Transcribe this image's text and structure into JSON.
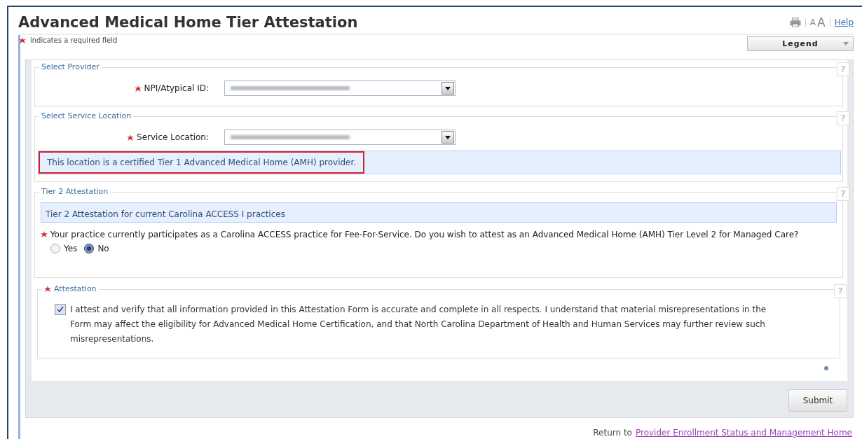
{
  "page": {
    "title": "Advanced Medical Home Tier Attestation",
    "text_size_small": "A",
    "text_size_large": "A",
    "help": "Help"
  },
  "required_note": "indicates a required field",
  "legend": {
    "label": "Legend"
  },
  "sections": [
    {
      "kind": "select",
      "legend": "Select Provider",
      "help_mark": "?",
      "field": {
        "label": "NPI/Atypical ID:",
        "required": true
      }
    },
    {
      "kind": "select",
      "legend": "Select Service Location",
      "help_mark": "?",
      "field": {
        "label": "Service Location:",
        "required": true
      },
      "notice": "This location is a certified Tier 1 Advanced Medical Home (AMH) provider.",
      "notice_highlighted": true
    },
    {
      "kind": "question",
      "legend": "Tier 2 Attestation",
      "help_mark": "?",
      "banner": "Tier 2 Attestation for current Carolina ACCESS I practices",
      "question": "Your practice currently participates as a Carolina ACCESS practice for Fee-For-Service. Do you wish to attest as an Advanced Medical Home (AMH) Tier Level 2 for Managed Care?",
      "required": true,
      "options": [
        {
          "label": "Yes",
          "selected": false
        },
        {
          "label": "No",
          "selected": true
        }
      ]
    },
    {
      "kind": "attestation",
      "legend": "Attestation",
      "help_mark": "?",
      "required": true,
      "checked": true,
      "text": "I attest and verify that all information provided in this Attestation Form is accurate and complete in all respects. I understand that material misrepresentations in the Form may affect the eligibility for Advanced Medical Home Certification, and that North Carolina Department of Health and Human Services may further review such misrepresentations."
    }
  ],
  "submit": "Submit",
  "footer": {
    "prefix": "Return to",
    "link": "Provider Enrollment Status and Management Home"
  }
}
